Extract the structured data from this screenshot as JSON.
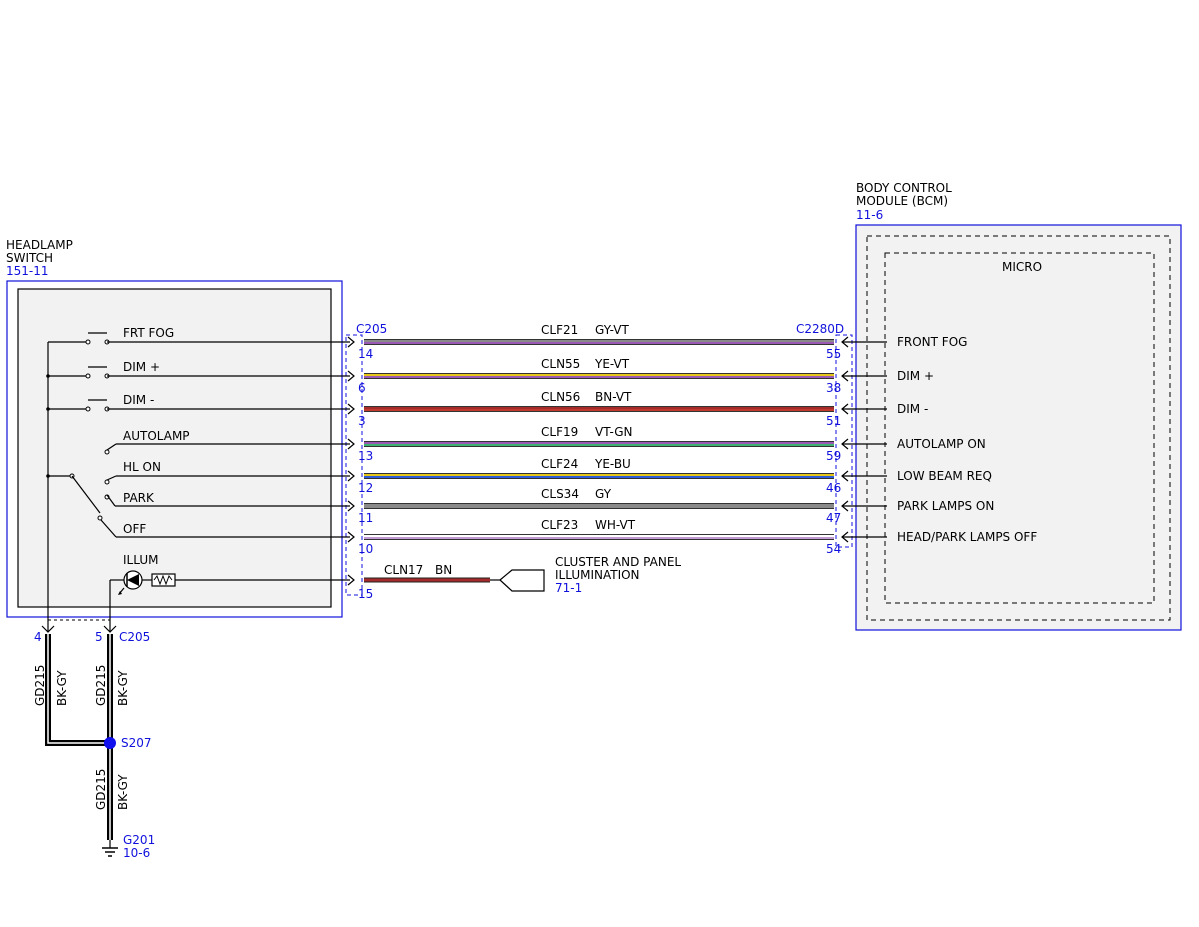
{
  "headlamp_switch": {
    "name": [
      "HEADLAMP",
      "SWITCH"
    ],
    "ref": "151-11"
  },
  "bcm": {
    "name": [
      "BODY CONTROL",
      "MODULE (BCM)"
    ],
    "ref": "11-6",
    "micro_label": "MICRO"
  },
  "switch_positions": [
    "FRT FOG",
    "DIM +",
    "DIM -",
    "AUTOLAMP",
    "HL ON",
    "PARK",
    "OFF"
  ],
  "illum_label": "ILLUM",
  "left_connector": "C205",
  "right_connector": "C2280D",
  "wires": [
    {
      "circuit": "CLF21",
      "color_code": "GY-VT",
      "left_pin": "14",
      "right_pin": "55",
      "signal": "FRONT FOG",
      "c1": "#8a8a8a",
      "c2": "#9b59b6"
    },
    {
      "circuit": "CLN55",
      "color_code": "YE-VT",
      "left_pin": "6",
      "right_pin": "38",
      "signal": "DIM +",
      "c1": "#e6c619",
      "c2": "#9b59b6"
    },
    {
      "circuit": "CLN56",
      "color_code": "BN-VT",
      "left_pin": "3",
      "right_pin": "51",
      "signal": "DIM -",
      "c1": "#a52a2a",
      "c2": "#c0392b"
    },
    {
      "circuit": "CLF19",
      "color_code": "VT-GN",
      "left_pin": "13",
      "right_pin": "59",
      "signal": "AUTOLAMP ON",
      "c1": "#9b59b6",
      "c2": "#3cb371"
    },
    {
      "circuit": "CLF24",
      "color_code": "YE-BU",
      "left_pin": "12",
      "right_pin": "46",
      "signal": "LOW BEAM REQ",
      "c1": "#e6c619",
      "c2": "#2e5cd6"
    },
    {
      "circuit": "CLS34",
      "color_code": "GY",
      "left_pin": "11",
      "right_pin": "47",
      "signal": "PARK LAMPS ON",
      "c1": "#8a8a8a",
      "c2": "#8a8a8a"
    },
    {
      "circuit": "CLF23",
      "color_code": "WH-VT",
      "left_pin": "10",
      "right_pin": "54",
      "signal": "HEAD/PARK LAMPS OFF",
      "c1": "#ffffff",
      "c2": "#c39bd3"
    }
  ],
  "illum_wire": {
    "circuit": "CLN17",
    "color_code": "BN",
    "left_pin": "15",
    "c1": "#a52a2a",
    "c2": "#a52a2a"
  },
  "cluster": {
    "label": [
      "CLUSTER AND PANEL",
      "ILLUMINATION"
    ],
    "ref": "71-1"
  },
  "ground": {
    "pin_a": "4",
    "pin_b": "5",
    "connector": "C205",
    "circuit": "GD215",
    "color_code": "BK-GY",
    "splice": "S207",
    "ground_id": "G201",
    "ground_ref": "10-6"
  }
}
